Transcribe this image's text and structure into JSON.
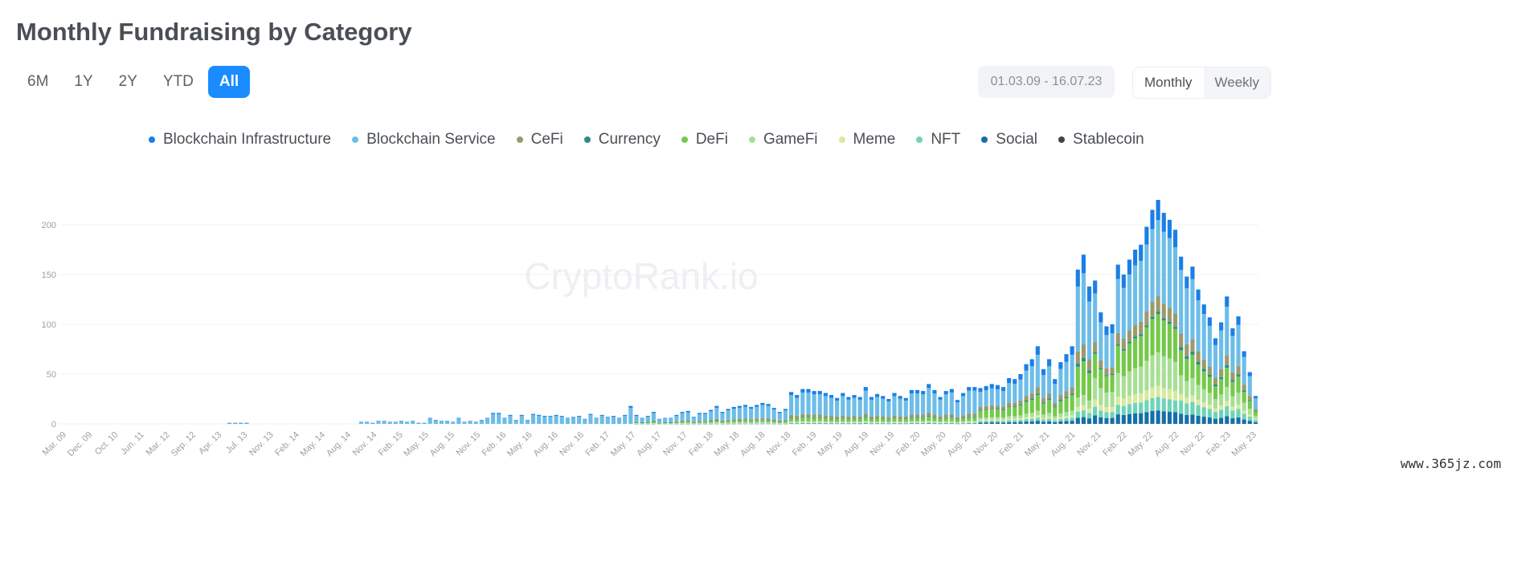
{
  "header": {
    "title": "Monthly Fundraising by Category"
  },
  "range_buttons": [
    {
      "label": "6M",
      "active": false
    },
    {
      "label": "1Y",
      "active": false
    },
    {
      "label": "2Y",
      "active": false
    },
    {
      "label": "YTD",
      "active": false
    },
    {
      "label": "All",
      "active": true
    }
  ],
  "date_range": "01.03.09 - 16.07.23",
  "period": {
    "monthly": "Monthly",
    "weekly": "Weekly",
    "active": "Monthly"
  },
  "watermark": "CryptoRank.io",
  "site_tag": "www.365jz.com",
  "colors": {
    "Blockchain Infrastructure": "#1a7fe6",
    "Blockchain Service": "#6dbde8",
    "CeFi": "#9a9a6e",
    "Currency": "#2a8c8c",
    "DeFi": "#74c94a",
    "GameFi": "#a8df95",
    "Meme": "#d8ea9e",
    "NFT": "#6fd3b9",
    "Social": "#156fa8",
    "Stablecoin": "#444444"
  },
  "chart_data": {
    "type": "bar",
    "stacked": true,
    "title": "Monthly Fundraising by Category",
    "ylim": [
      0,
      225
    ],
    "yticks": [
      0,
      50,
      100,
      150,
      200
    ],
    "x_tick_labels": [
      "Mar. 09",
      "Dec. 09",
      "Oct. 10",
      "Jun. 11",
      "Mar. 12",
      "Sep. 12",
      "Apr. 13",
      "Jul. 13",
      "Nov. 13",
      "Feb. 14",
      "May. 14",
      "Aug. 14",
      "Nov. 14",
      "Feb. 15",
      "May. 15",
      "Aug. 15",
      "Nov. 15",
      "Feb. 16",
      "May. 16",
      "Aug. 16",
      "Nov. 16",
      "Feb. 17",
      "May. 17",
      "Aug. 17",
      "Nov. 17",
      "Feb. 18",
      "May. 18",
      "Aug. 18",
      "Nov. 18",
      "Feb. 19",
      "May. 19",
      "Aug. 19",
      "Nov. 19",
      "Feb. 20",
      "May. 20",
      "Aug. 20",
      "Nov. 20",
      "Feb. 21",
      "May. 21",
      "Aug. 21",
      "Nov. 21",
      "Feb. 22",
      "May. 22",
      "Aug. 22",
      "Nov. 22",
      "Feb. 23",
      "May. 23"
    ],
    "legend_position": "top-center",
    "series_names": [
      "Blockchain Infrastructure",
      "Blockchain Service",
      "CeFi",
      "Currency",
      "DeFi",
      "GameFi",
      "Meme",
      "NFT",
      "Social",
      "Stablecoin"
    ],
    "totals": [
      0,
      0,
      0,
      0,
      0,
      0,
      0,
      0,
      0,
      0,
      0,
      0,
      0,
      0,
      0,
      0,
      0,
      0,
      0,
      0,
      0,
      0,
      0,
      0,
      0,
      0,
      0,
      0,
      0,
      1,
      1,
      1,
      1,
      0,
      0,
      0,
      0,
      0,
      0,
      0,
      0,
      0,
      0,
      0,
      0,
      0,
      0,
      0,
      0,
      0,
      0,
      0,
      2,
      2,
      1,
      3,
      3,
      2,
      2,
      3,
      2,
      3,
      1,
      1,
      6,
      4,
      3,
      3,
      2,
      6,
      2,
      3,
      2,
      4,
      6,
      11,
      11,
      6,
      9,
      4,
      9,
      4,
      10,
      9,
      8,
      8,
      9,
      8,
      6,
      7,
      8,
      5,
      10,
      6,
      9,
      7,
      8,
      6,
      9,
      18,
      9,
      6,
      8,
      12,
      5,
      6,
      6,
      9,
      12,
      13,
      7,
      11,
      11,
      14,
      18,
      12,
      15,
      17,
      18,
      19,
      17,
      19,
      21,
      20,
      16,
      12,
      15,
      32,
      29,
      35,
      35,
      33,
      33,
      31,
      29,
      26,
      31,
      27,
      29,
      27,
      37,
      27,
      30,
      28,
      25,
      31,
      28,
      26,
      34,
      34,
      33,
      40,
      34,
      27,
      33,
      35,
      24,
      31,
      37,
      37,
      36,
      38,
      40,
      39,
      37,
      46,
      45,
      50,
      60,
      65,
      78,
      55,
      65,
      45,
      62,
      70,
      78,
      155,
      170,
      138,
      144,
      112,
      98,
      100,
      160,
      150,
      165,
      175,
      180,
      198,
      215,
      225,
      212,
      205,
      195,
      168,
      148,
      158,
      135,
      120,
      107,
      86,
      102,
      128,
      96,
      108,
      73,
      52,
      28
    ],
    "composition_by_era": [
      {
        "until_index": 100,
        "shares": [
          0.1,
          0.9,
          0,
          0,
          0,
          0,
          0,
          0,
          0,
          0
        ]
      },
      {
        "until_index": 160,
        "shares": [
          0.1,
          0.62,
          0.08,
          0.02,
          0.1,
          0.03,
          0.02,
          0.02,
          0.01,
          0
        ]
      },
      {
        "until_index": 180,
        "shares": [
          0.11,
          0.42,
          0.08,
          0.02,
          0.2,
          0.06,
          0.03,
          0.04,
          0.04,
          0
        ]
      },
      {
        "until_index": 195,
        "shares": [
          0.09,
          0.34,
          0.07,
          0.01,
          0.17,
          0.15,
          0.05,
          0.06,
          0.06,
          0
        ]
      },
      {
        "until_index": 211,
        "shares": [
          0.08,
          0.38,
          0.08,
          0.02,
          0.15,
          0.11,
          0.04,
          0.08,
          0.06,
          0
        ]
      }
    ]
  }
}
